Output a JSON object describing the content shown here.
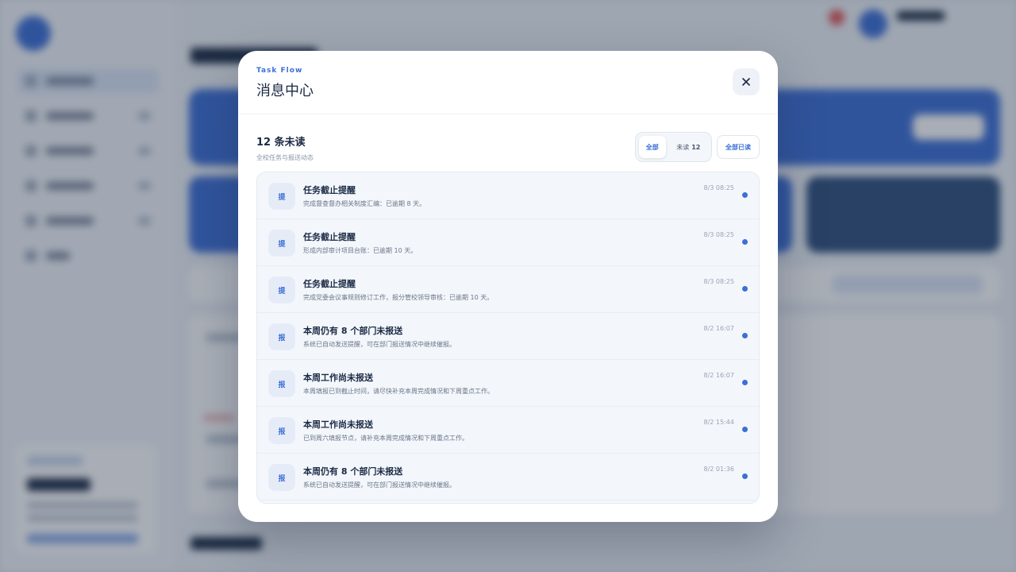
{
  "modal": {
    "brand": "Task Flow",
    "title": "消息中心",
    "unread_summary": "12 条未读",
    "subtitle": "全校任务与报送动态",
    "filter_all": "全部",
    "filter_unread_label": "未读",
    "filter_unread_count": "12",
    "mark_all_read": "全部已读",
    "close_icon": "close-icon"
  },
  "notifications": [
    {
      "icon": "提",
      "title": "任务截止提醒",
      "desc": "完成督查督办相关制度汇编：已逾期 8 天。",
      "time": "8/3 08:25",
      "unread": true
    },
    {
      "icon": "提",
      "title": "任务截止提醒",
      "desc": "形成内部审计项目台账：已逾期 10 天。",
      "time": "8/3 08:25",
      "unread": true
    },
    {
      "icon": "提",
      "title": "任务截止提醒",
      "desc": "完成党委会议事规则修订工作，报分管校领导审核：已逾期 10 天。",
      "time": "8/3 08:25",
      "unread": true
    },
    {
      "icon": "报",
      "title": "本周仍有 8 个部门未报送",
      "desc": "系统已自动发送提醒，可在部门报送情况中继续催报。",
      "time": "8/2 16:07",
      "unread": true
    },
    {
      "icon": "报",
      "title": "本周工作尚未报送",
      "desc": "本周填报已到截止时间，请尽快补充本周完成情况和下周重点工作。",
      "time": "8/2 16:07",
      "unread": true
    },
    {
      "icon": "报",
      "title": "本周工作尚未报送",
      "desc": "已到周六填报节点，请补充本周完成情况和下周重点工作。",
      "time": "8/2 15:44",
      "unread": true
    },
    {
      "icon": "报",
      "title": "本周仍有 8 个部门未报送",
      "desc": "系统已自动发送提醒，可在部门报送情况中继续催报。",
      "time": "8/2 01:36",
      "unread": true
    }
  ],
  "colors": {
    "accent": "#3d6fd6",
    "scrim": "rgba(30,42,64,0.38)"
  }
}
